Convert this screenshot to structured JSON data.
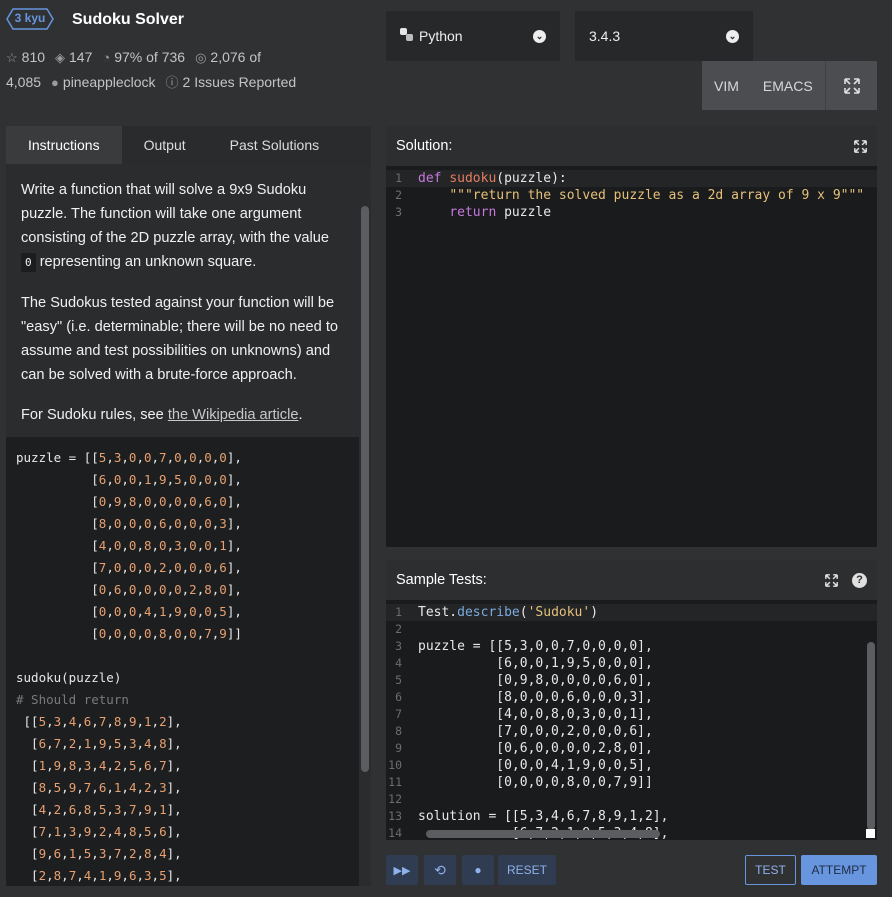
{
  "header": {
    "kyu_label": "3 kyu",
    "title": "Sudoku Solver",
    "stars": "810",
    "collections": "147",
    "satisfaction": "97% of 736",
    "completed_part1": "2,076 of",
    "completed_part2": "4,085",
    "author": "pineappleclock",
    "issues": "2 Issues Reported"
  },
  "language": {
    "selected": "Python",
    "version": "3.4.3"
  },
  "modes": {
    "vim": "VIM",
    "emacs": "EMACS"
  },
  "tabs": [
    "Instructions",
    "Output",
    "Past Solutions"
  ],
  "instructions": {
    "p1_before": "Write a function that will solve a 9x9 Sudoku puzzle. The function will take one argument consisting of the 2D puzzle array, with the value",
    "p1_code": "0",
    "p1_after": "representing an unknown square.",
    "p2": "The Sudokus tested against your function will be \"easy\" (i.e. determinable; there will be no need to assume and test possibilities on unknowns) and can be solved with a brute-force approach.",
    "p3_before": "For Sudoku rules, see",
    "p3_link": "the Wikipedia article",
    "p3_after": "."
  },
  "solution": {
    "title": "Solution:",
    "lines": [
      "def sudoku(puzzle):",
      "    \"\"\"return the solved puzzle as a 2d array of 9 x 9\"\"\"",
      "    return puzzle"
    ]
  },
  "tests": {
    "title": "Sample Tests:"
  },
  "buttons": {
    "reset": "RESET",
    "test": "TEST",
    "attempt": "ATTEMPT"
  }
}
